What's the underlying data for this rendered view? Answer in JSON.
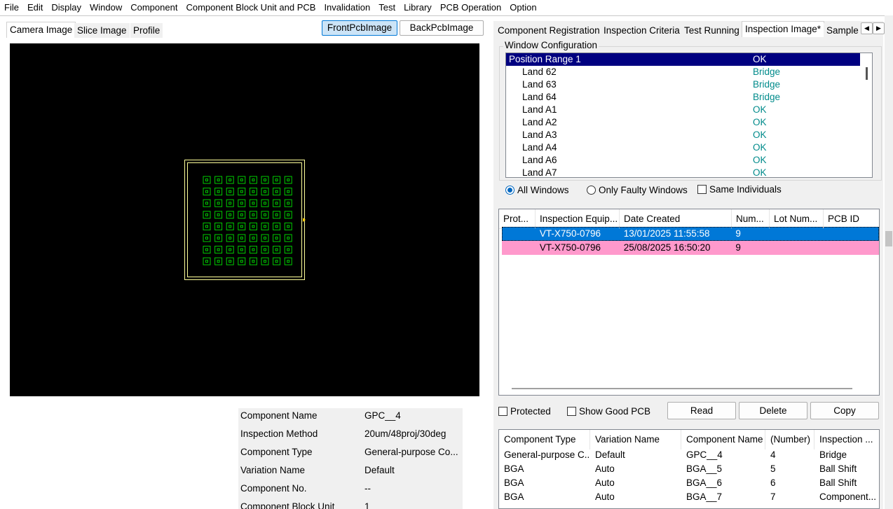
{
  "menu": [
    "File",
    "Edit",
    "Display",
    "Window",
    "Component",
    "Component Block Unit and PCB",
    "Invalidation",
    "Test",
    "Library",
    "PCB Operation",
    "Option"
  ],
  "left_tabs": [
    "Camera Image",
    "Slice Image",
    "Profile"
  ],
  "pcb_buttons": {
    "front": "FrontPcbImage",
    "back": "BackPcbImage"
  },
  "camera": {
    "grid_rows": 8,
    "grid_cols": 8,
    "pad_color": "#00cc00",
    "outline_color": "#ffff99"
  },
  "properties": [
    {
      "label": "Component Name",
      "value": "GPC__4"
    },
    {
      "label": "Inspection Method",
      "value": "20um/48proj/30deg"
    },
    {
      "label": "Component Type",
      "value": "General-purpose Co..."
    },
    {
      "label": "Variation Name",
      "value": "Default"
    },
    {
      "label": "Component No.",
      "value": "--"
    },
    {
      "label": "Component Block Unit",
      "value": "1"
    }
  ],
  "right_tabs": [
    "Component Registration",
    "Inspection Criteria",
    "Test Running",
    "Inspection Image*",
    "Sample"
  ],
  "window_config": {
    "title": "Window Configuration",
    "rows": [
      {
        "name": "Position Range 1",
        "result": "OK"
      },
      {
        "name": "Land 62",
        "result": "Bridge"
      },
      {
        "name": "Land 63",
        "result": "Bridge"
      },
      {
        "name": "Land 64",
        "result": "Bridge"
      },
      {
        "name": "Land A1",
        "result": "OK"
      },
      {
        "name": "Land A2",
        "result": "OK"
      },
      {
        "name": "Land A3",
        "result": "OK"
      },
      {
        "name": "Land A4",
        "result": "OK"
      },
      {
        "name": "Land A6",
        "result": "OK"
      },
      {
        "name": "Land A7",
        "result": "OK"
      }
    ],
    "filters": {
      "all": "All Windows",
      "faulty": "Only Faulty Windows",
      "same": "Same Individuals"
    }
  },
  "history": {
    "columns": [
      "Prot...",
      "Inspection Equip...",
      "Date Created",
      "Num...",
      "Lot Num...",
      "PCB ID"
    ],
    "rows": [
      {
        "prot": "",
        "equip": "VT-X750-0796",
        "date": "13/01/2025  11:55:58",
        "num": "9",
        "lot": "",
        "pcb": ""
      },
      {
        "prot": "",
        "equip": "VT-X750-0796",
        "date": "25/08/2025  16:50:20",
        "num": "9",
        "lot": "",
        "pcb": ""
      }
    ]
  },
  "history_controls": {
    "protected": "Protected",
    "show_good": "Show Good PCB",
    "read": "Read",
    "delete": "Delete",
    "copy": "Copy"
  },
  "components": {
    "columns": [
      "Component Type",
      "Variation Name",
      "Component Name",
      "(Number)",
      "Inspection ..."
    ],
    "rows": [
      {
        "type": "General-purpose C...",
        "variation": "Default",
        "name": "GPC__4",
        "number": "4",
        "inspection": "Bridge"
      },
      {
        "type": "BGA",
        "variation": "Auto",
        "name": "BGA__5",
        "number": "5",
        "inspection": "Ball Shift"
      },
      {
        "type": "BGA",
        "variation": "Auto",
        "name": "BGA__6",
        "number": "6",
        "inspection": "Ball Shift"
      },
      {
        "type": "BGA",
        "variation": "Auto",
        "name": "BGA__7",
        "number": "7",
        "inspection": "Component..."
      }
    ]
  }
}
